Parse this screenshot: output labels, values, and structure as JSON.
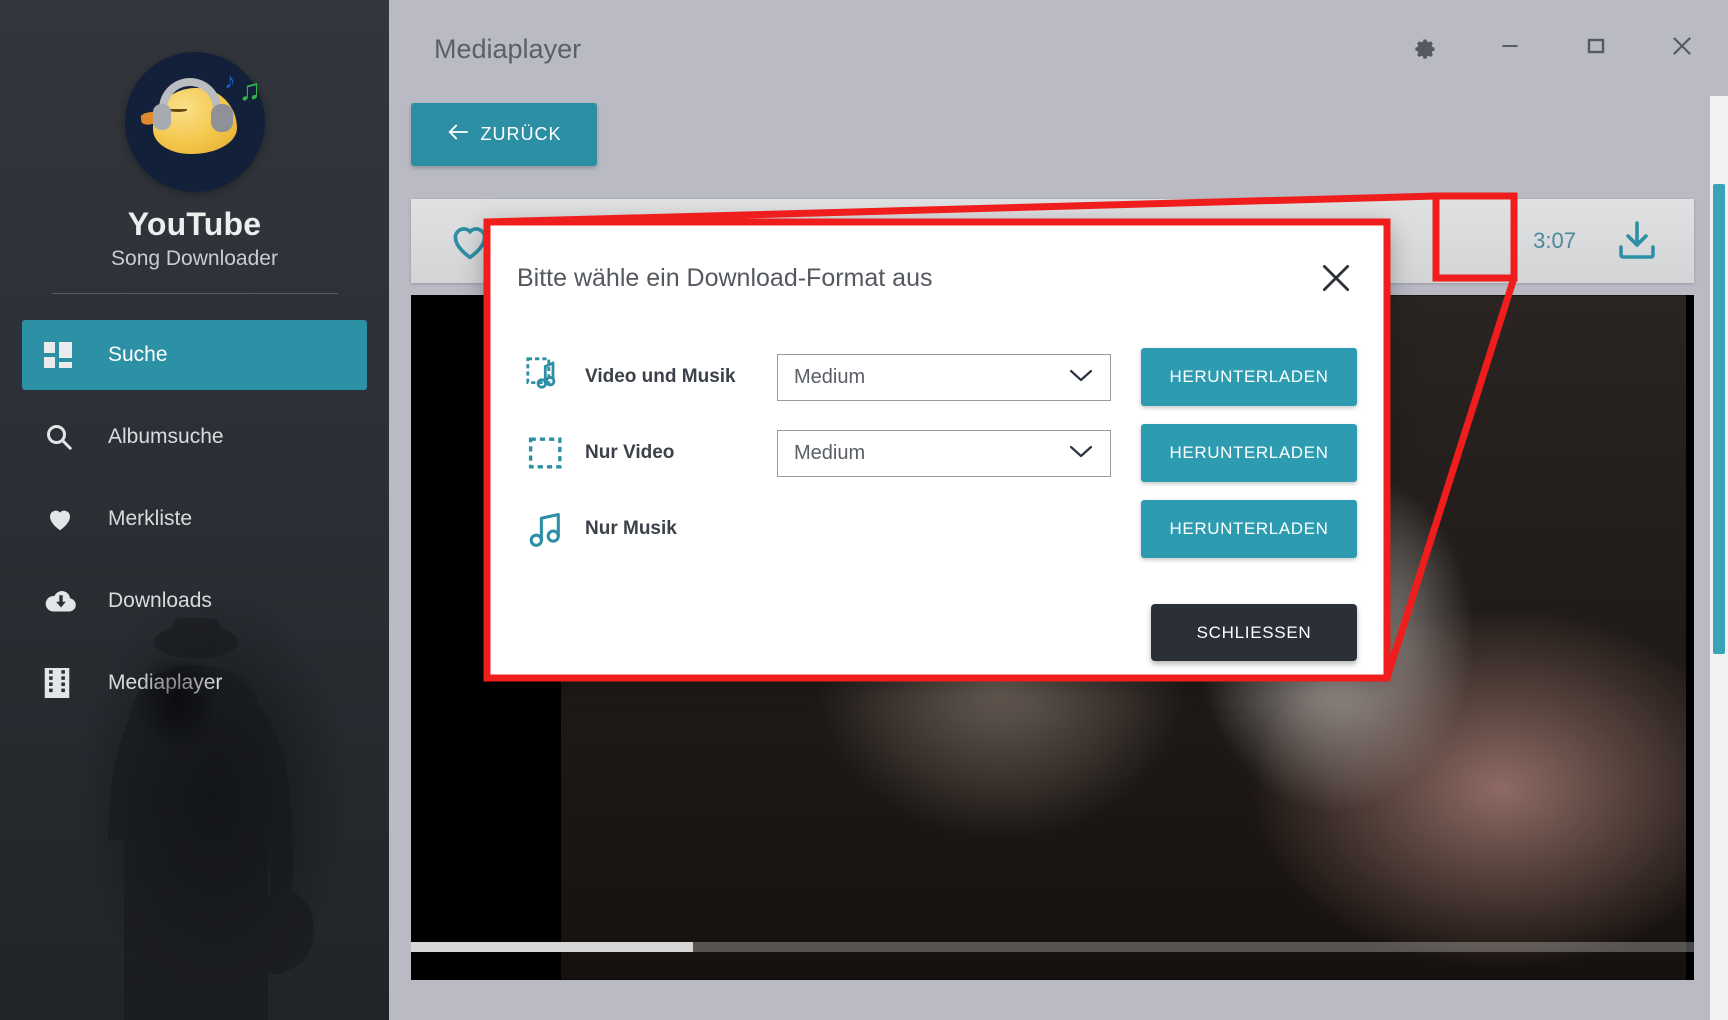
{
  "sidebar": {
    "app_title": "YouTube",
    "app_subtitle": "Song Downloader",
    "items": [
      {
        "label": "Suche",
        "icon": "grid-icon",
        "active": true
      },
      {
        "label": "Albumsuche",
        "icon": "search-icon",
        "active": false
      },
      {
        "label": "Merkliste",
        "icon": "heart-icon",
        "active": false
      },
      {
        "label": "Downloads",
        "icon": "cloud-download-icon",
        "active": false
      },
      {
        "label": "Mediaplayer",
        "icon": "film-icon",
        "active": false
      }
    ]
  },
  "window": {
    "title": "Mediaplayer",
    "controls": {
      "settings": "gear-icon",
      "minimize": "minimize-icon",
      "maximize": "maximize-icon",
      "close": "close-icon"
    }
  },
  "toolbar": {
    "back_label": "ZURÜCK",
    "back_icon": "arrow-left-icon"
  },
  "media_row": {
    "favorite_icon": "heart-outline-icon",
    "duration": "3:07",
    "download_icon": "download-tray-icon"
  },
  "modal": {
    "title": "Bitte wähle ein Download-Format aus",
    "close_icon": "close-icon",
    "rows": [
      {
        "icon": "film-music-icon",
        "label": "Video und Musik",
        "has_select": true,
        "select_value": "Medium",
        "select_options": [
          "Medium"
        ],
        "button_label": "HERUNTERLADEN"
      },
      {
        "icon": "film-icon",
        "label": "Nur Video",
        "has_select": true,
        "select_value": "Medium",
        "select_options": [
          "Medium"
        ],
        "button_label": "HERUNTERLADEN"
      },
      {
        "icon": "music-note-icon",
        "label": "Nur Musik",
        "has_select": false,
        "select_value": "",
        "select_options": [],
        "button_label": "HERUNTERLADEN"
      }
    ],
    "close_button_label": "SCHLIESSEN"
  },
  "colors": {
    "accent": "#2d8fa4",
    "accent_button": "#2d9cb0",
    "sidebar_bg": "#2b2f35",
    "dark_button": "#2b2f38",
    "annotation": "#f01d1d",
    "window_bg": "#b9bac4"
  }
}
